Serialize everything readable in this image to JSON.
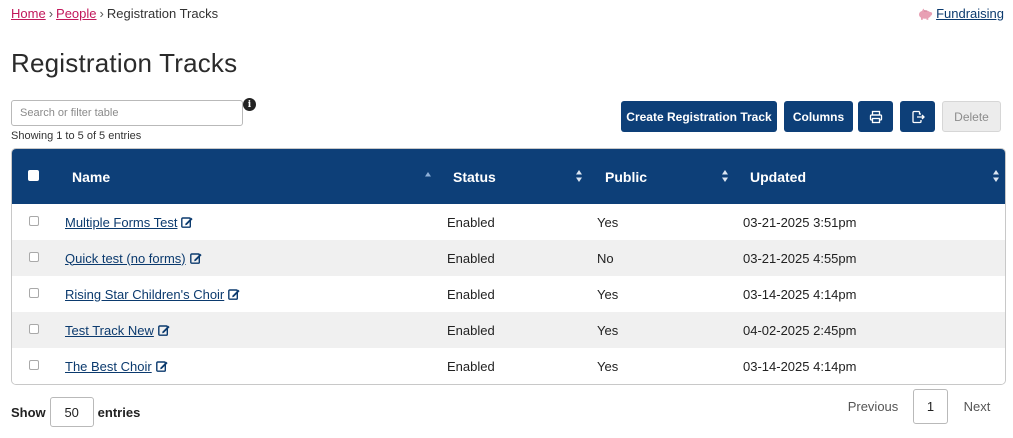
{
  "breadcrumb": {
    "items": [
      {
        "label": "Home"
      },
      {
        "label": "People"
      }
    ],
    "separator": "›",
    "current": "Registration Tracks"
  },
  "topbar": {
    "fundraising_label": "Fundraising",
    "fundraising_icon": "piggy-bank-icon",
    "accent_color": "#e8a0b4"
  },
  "page_title": "Registration Tracks",
  "search": {
    "placeholder": "Search or filter table",
    "value": ""
  },
  "showing_text": "Showing 1 to 5 of 5 entries",
  "toolbar": {
    "create_label": "Create Registration Track",
    "columns_label": "Columns",
    "print_icon": "printer-icon",
    "export_icon": "export-icon",
    "delete_label": "Delete"
  },
  "colors": {
    "primary": "#0d3f78",
    "link": "#0b3a6e",
    "breadcrumb_link": "#c2185b",
    "row_alt": "#f0f0f0"
  },
  "table": {
    "columns": [
      {
        "label": "Name",
        "sort": "asc"
      },
      {
        "label": "Status",
        "sort": "none"
      },
      {
        "label": "Public",
        "sort": "none"
      },
      {
        "label": "Updated",
        "sort": "none"
      }
    ],
    "rows": [
      {
        "name": "Multiple Forms Test",
        "status": "Enabled",
        "public": "Yes",
        "updated": "03-21-2025 3:51pm"
      },
      {
        "name": "Quick test (no forms)",
        "status": "Enabled",
        "public": "No",
        "updated": "03-21-2025 4:55pm"
      },
      {
        "name": "Rising Star Children's Choir",
        "status": "Enabled",
        "public": "Yes",
        "updated": "03-14-2025 4:14pm"
      },
      {
        "name": "Test Track New",
        "status": "Enabled",
        "public": "Yes",
        "updated": "04-02-2025 2:45pm"
      },
      {
        "name": "The Best Choir",
        "status": "Enabled",
        "public": "Yes",
        "updated": "03-14-2025 4:14pm"
      }
    ]
  },
  "footer": {
    "show_label": "Show",
    "entries_value": "50",
    "entries_label": "entries"
  },
  "pagination": {
    "previous_label": "Previous",
    "current_page": "1",
    "next_label": "Next"
  }
}
